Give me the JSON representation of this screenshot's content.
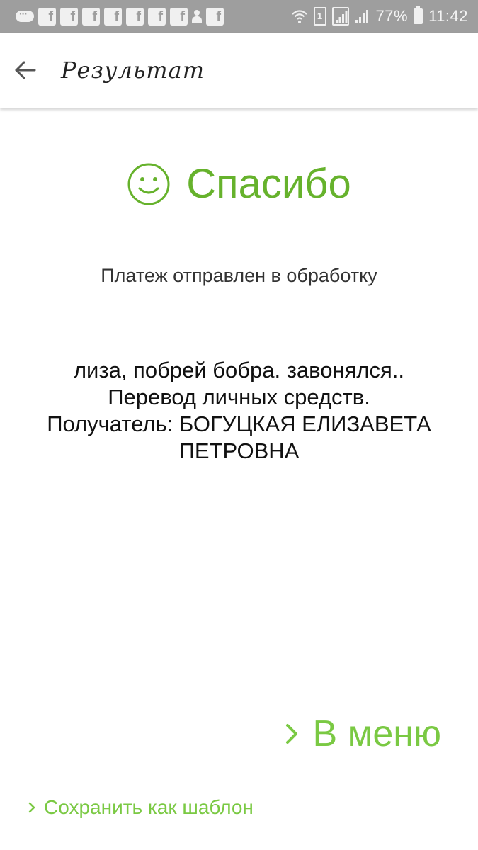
{
  "status_bar": {
    "sim_label": "1",
    "battery_percent": "77%",
    "time": "11:42"
  },
  "app_bar": {
    "title": "Результат"
  },
  "result": {
    "heading": "Спасибо",
    "status": "Платеж отправлен в обработку",
    "details": [
      "лиза, побрей бобра. завонялся..",
      "Перевод личных средств.",
      "Получатель: БОГУЦКАЯ ЕЛИЗАВЕТА",
      "ПЕТРОВНА"
    ]
  },
  "actions": {
    "menu_label": "В меню",
    "save_template_label": "Сохранить как шаблон"
  },
  "colors": {
    "accent_dark": "#66b22c",
    "accent_light": "#7ac943",
    "status_bar": "#9e9e9e"
  },
  "icons": {
    "back": "arrow-left-icon",
    "thanks": "smiley-icon",
    "chevron": "chevron-right-icon"
  }
}
